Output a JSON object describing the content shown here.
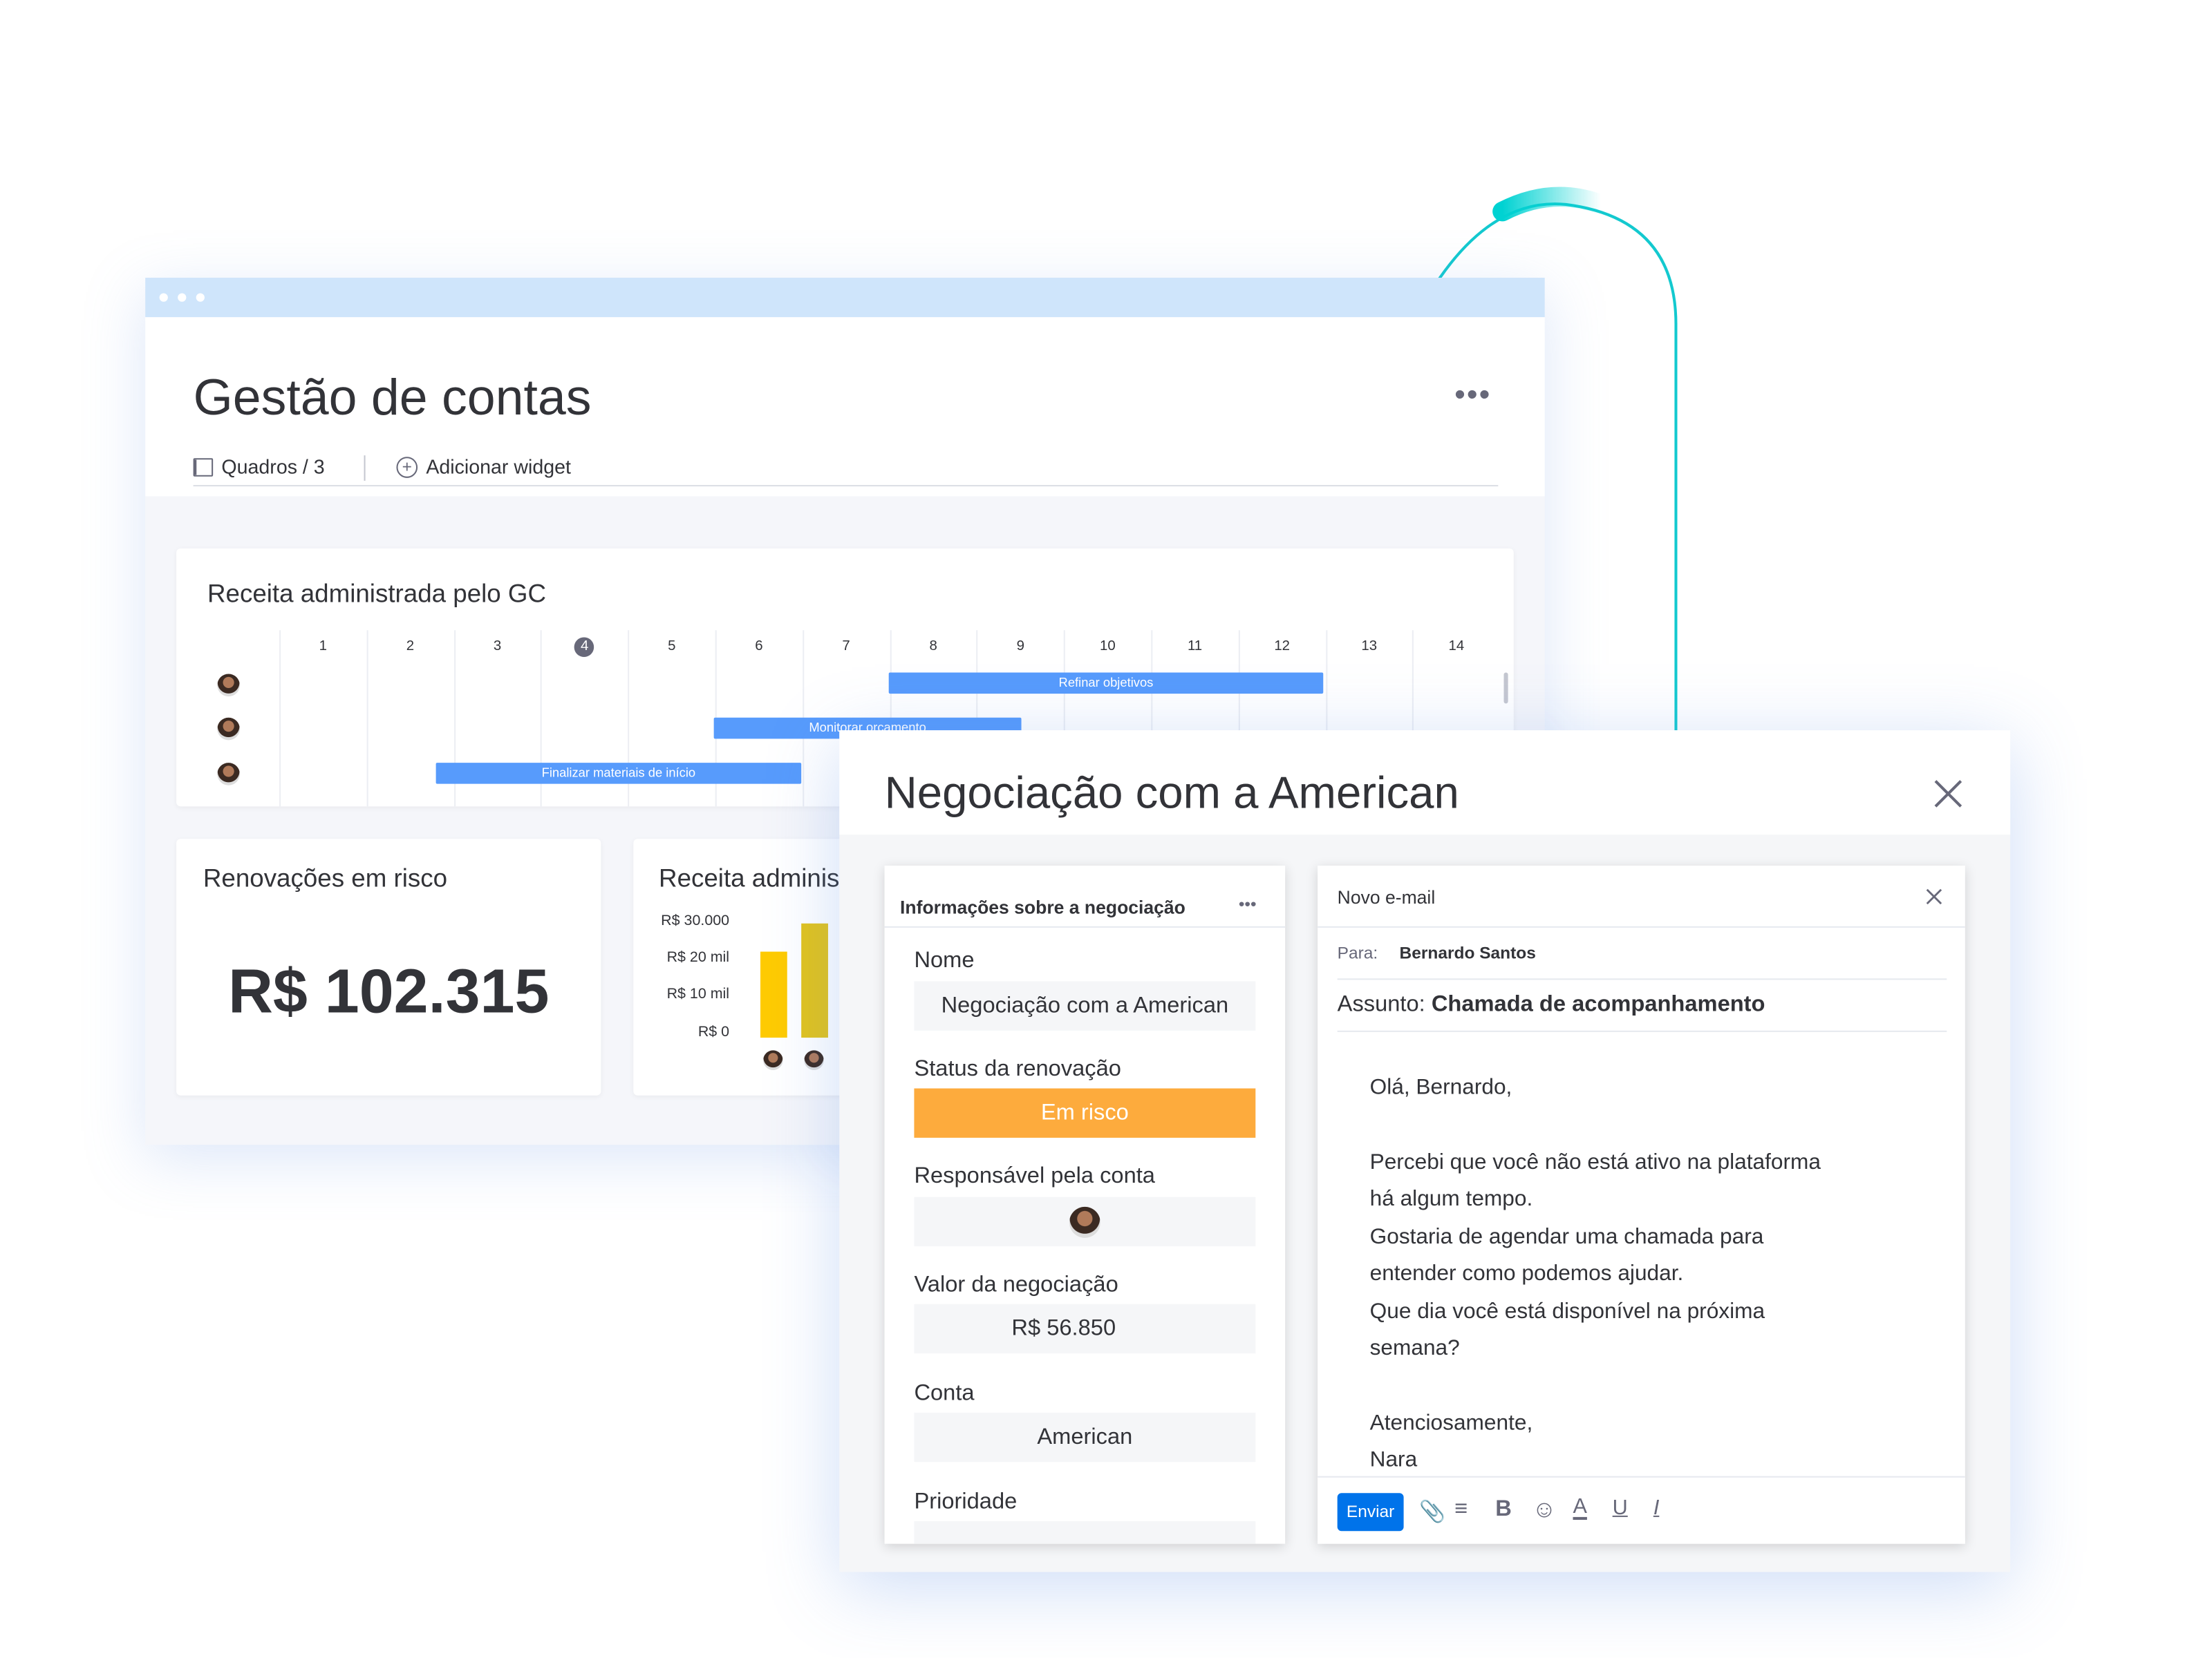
{
  "dashboard": {
    "title": "Gestão de contas",
    "more_label": "•••",
    "boards_label": "Quadros / 3",
    "add_widget_label": "Adicionar widget",
    "timeline": {
      "title": "Receita administrada pelo GC",
      "columns": [
        "1",
        "2",
        "3",
        "4",
        "5",
        "6",
        "7",
        "8",
        "9",
        "10",
        "11",
        "12",
        "13",
        "14"
      ],
      "current_column": "4",
      "bars": [
        {
          "label": "Refinar objetivos",
          "start": 8,
          "end": 12
        },
        {
          "label": "Monitorar orçamento",
          "start": 6,
          "end": 9
        },
        {
          "label": "Finalizar materiais de início",
          "start": 2.8,
          "end": 6
        },
        {
          "label": "",
          "start": 0,
          "end": 0
        }
      ],
      "bar_color": "#579bfc"
    },
    "renewals": {
      "title": "Renovações em risco",
      "value": "R$ 102.315"
    },
    "revenue_chart": {
      "title": "Receita adminis",
      "ticks": [
        "R$ 30.000",
        "R$ 20 mil",
        "R$ 10 mil",
        "R$ 0"
      ],
      "bars": [
        {
          "value": 22500,
          "color": "#ffcb00"
        },
        {
          "value": 30000,
          "color": "#e2c31a"
        }
      ]
    }
  },
  "modal": {
    "title": "Negociação com a American",
    "info": {
      "header": "Informações sobre a negociação",
      "more_label": "•••",
      "fields": {
        "name_label": "Nome",
        "name_value": "Negociação com a American",
        "status_label": "Status da renovação",
        "status_value": "Em risco",
        "status_color": "#fdab3d",
        "owner_label": "Responsável pela conta",
        "deal_value_label": "Valor da negociação",
        "deal_value": "R$ 56.850",
        "account_label": "Conta",
        "account_value": "American",
        "priority_label": "Prioridade"
      }
    },
    "email": {
      "header": "Novo e-mail",
      "to_label": "Para:",
      "to_value": "Bernardo Santos",
      "subject_label": "Assunto:",
      "subject_value": "Chamada de acompanhamento",
      "body": [
        "Olá, Bernardo,",
        "Percebi que você não está ativo na plataforma",
        "há algum tempo.",
        "Gostaria de agendar uma chamada para",
        "entender como podemos ajudar.",
        "Que dia você está disponível na próxima",
        "semana?",
        "Atenciosamente,",
        "Nara"
      ],
      "send_label": "Enviar",
      "send_color": "#0073ea",
      "toolbar_icons": [
        "paperclip-icon",
        "list-icon",
        "bold-icon",
        "emoji-icon",
        "text-color-icon",
        "underline-icon",
        "italic-icon"
      ]
    }
  }
}
